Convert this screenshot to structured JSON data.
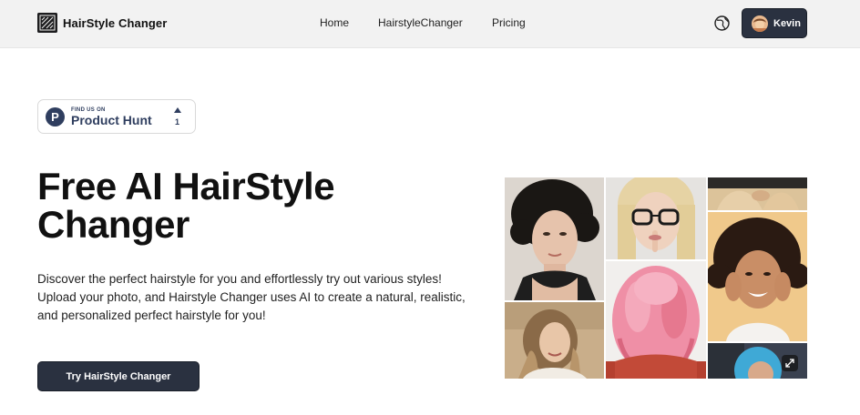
{
  "header": {
    "brand_name": "HairStyle Changer",
    "nav": [
      {
        "label": "Home"
      },
      {
        "label": "HairstyleChanger"
      },
      {
        "label": "Pricing"
      }
    ],
    "user_name": "Kevin",
    "icons": {
      "logo": "hatched-square-logo",
      "language": "globe-icon",
      "avatar": "user-avatar"
    }
  },
  "badge": {
    "small_text": "FIND US ON",
    "big_text": "Product Hunt",
    "letter": "P",
    "upvotes": "1",
    "color": "#2f3e5f"
  },
  "hero": {
    "title": "Free AI HairStyle Changer",
    "description": "Discover the perfect hairstyle for you and effortlessly try out various styles! Upload your photo, and Hairstyle Changer uses AI to create a natural, realistic, and personalized perfect hairstyle for you!",
    "cta_label": "Try HairStyle Changer"
  },
  "gallery": {
    "images": [
      {
        "name": "curly-dark-hair-woman"
      },
      {
        "name": "wavy-blonde-hair-woman"
      },
      {
        "name": "blonde-woman-glasses"
      },
      {
        "name": "pink-wavy-hair"
      },
      {
        "name": "hands-on-knees-crop"
      },
      {
        "name": "curly-hair-woman-smiling"
      },
      {
        "name": "blue-hair-woman"
      }
    ],
    "expand_icon": "expand-icon"
  },
  "colors": {
    "accent": "#2a3140",
    "header_bg": "#f2f2f2",
    "text": "#111111"
  }
}
